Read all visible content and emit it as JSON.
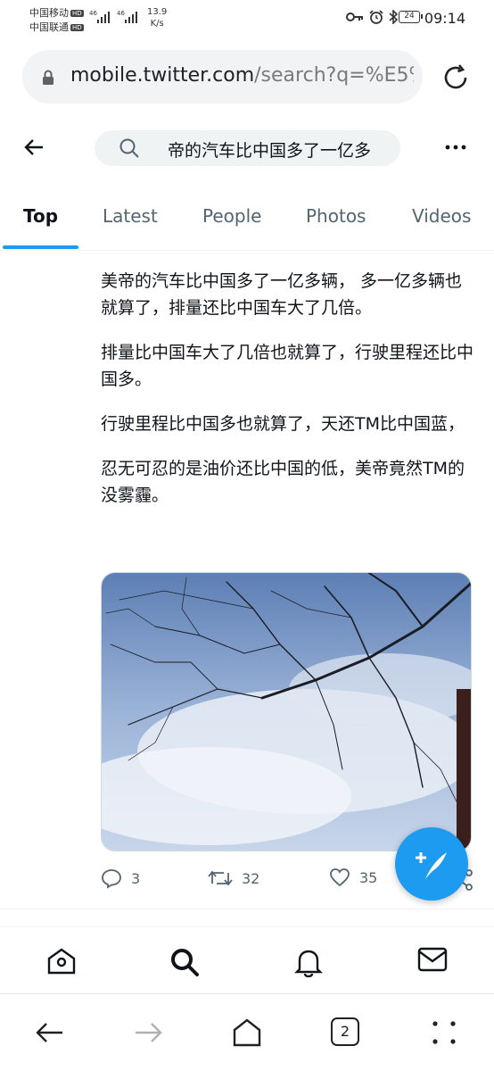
{
  "status_bar": {
    "carrier1": "中国移动",
    "carrier2": "中国联通",
    "hd": "HD",
    "net1": "46",
    "net2": "46",
    "speed_value": "13.9",
    "speed_unit": "K/s",
    "battery": "24",
    "time": "09:14"
  },
  "browser": {
    "url_host": "mobile.twitter.com",
    "url_path": "/search?q=%E5%",
    "tab_count": "2"
  },
  "search": {
    "query": "帝的汽车比中国多了一亿多"
  },
  "tabs": [
    {
      "label": "Top",
      "active": true
    },
    {
      "label": "Latest",
      "active": false
    },
    {
      "label": "People",
      "active": false
    },
    {
      "label": "Photos",
      "active": false
    },
    {
      "label": "Videos",
      "active": false
    }
  ],
  "tweet": {
    "paragraphs": [
      "美帝的汽车比中国多了一亿多辆， 多一亿多辆也就算了，排量还比中国车大了几倍。",
      "排量比中国车大了几倍也就算了，行驶里程还比中国多。",
      "行驶里程比中国多也就算了，天还TM比中国蓝，",
      "忍无可忍的是油价还比中国的低，美帝竟然TM的没雾霾。"
    ],
    "replies": "3",
    "retweets": "32",
    "likes": "35"
  },
  "colors": {
    "accent": "#1d9bf0",
    "text": "#0f1419",
    "secondary": "#536471"
  },
  "icons": {
    "compose": "feather-plus-icon",
    "home": "home-icon",
    "explore": "search-icon",
    "notifications": "bell-icon",
    "messages": "envelope-icon"
  }
}
